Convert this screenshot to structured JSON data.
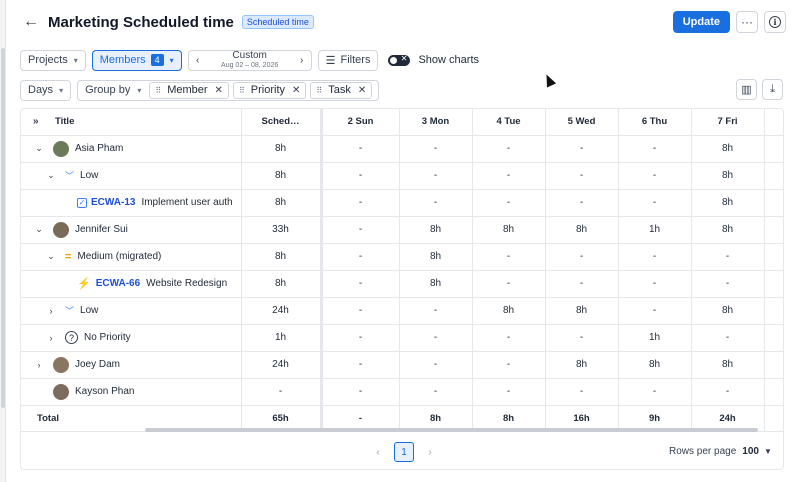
{
  "header": {
    "back_icon": "arrow-left-icon",
    "title": "Marketing Scheduled time",
    "badge": "Scheduled time",
    "update_label": "Update",
    "more_icon": "ellipsis-icon",
    "info_icon": "info-icon"
  },
  "toolbar": {
    "projects_label": "Projects",
    "members_label": "Members",
    "members_count": "4",
    "range_label": "Custom",
    "range_dates": "Aug 02 – 08, 2026",
    "filters_label": "Filters",
    "show_charts_label": "Show charts",
    "days_label": "Days",
    "group_by_label": "Group by",
    "group_chips": [
      "Member",
      "Priority",
      "Task"
    ]
  },
  "table": {
    "columns": [
      "Title",
      "Sched…",
      "2 Sun",
      "3 Mon",
      "4 Tue",
      "5 Wed",
      "6 Thu",
      "7 Fri"
    ],
    "rows": [
      {
        "level": 0,
        "caret": "⌄",
        "kind": "member",
        "name": "Asia Pham",
        "avatar_color": "#6b7b5a",
        "values": [
          "8h",
          "-",
          "-",
          "-",
          "-",
          "-",
          "8h"
        ]
      },
      {
        "level": 1,
        "caret": "⌄",
        "kind": "priority-low",
        "name": "Low",
        "values": [
          "8h",
          "-",
          "-",
          "-",
          "-",
          "-",
          "8h"
        ]
      },
      {
        "level": 2,
        "caret": "",
        "kind": "task-check",
        "tag": "ECWA-13",
        "name": "Implement user auth",
        "values": [
          "8h",
          "-",
          "-",
          "-",
          "-",
          "-",
          "8h"
        ]
      },
      {
        "level": 0,
        "caret": "⌄",
        "kind": "member",
        "name": "Jennifer Sui",
        "avatar_color": "#7a6a58",
        "values": [
          "33h",
          "-",
          "8h",
          "8h",
          "8h",
          "1h",
          "8h"
        ]
      },
      {
        "level": 1,
        "caret": "⌄",
        "kind": "priority-med",
        "name": "Medium (migrated)",
        "values": [
          "8h",
          "-",
          "8h",
          "-",
          "-",
          "-",
          "-"
        ]
      },
      {
        "level": 2,
        "caret": "",
        "kind": "task-bolt",
        "tag": "ECWA-66",
        "name": "Website Redesign",
        "values": [
          "8h",
          "-",
          "8h",
          "-",
          "-",
          "-",
          "-"
        ]
      },
      {
        "level": 1,
        "caret": "›",
        "kind": "priority-low",
        "name": "Low",
        "values": [
          "24h",
          "-",
          "-",
          "8h",
          "8h",
          "-",
          "8h"
        ]
      },
      {
        "level": 1,
        "caret": "›",
        "kind": "priority-none",
        "name": "No Priority",
        "values": [
          "1h",
          "-",
          "-",
          "-",
          "-",
          "1h",
          "-"
        ]
      },
      {
        "level": 0,
        "caret": "›",
        "kind": "member",
        "name": "Joey Dam",
        "avatar_color": "#8a7560",
        "values": [
          "24h",
          "-",
          "-",
          "-",
          "8h",
          "8h",
          "8h"
        ]
      },
      {
        "level": 0,
        "caret": "",
        "kind": "member",
        "name": "Kayson Phan",
        "avatar_color": "#7d6b5d",
        "values": [
          "-",
          "-",
          "-",
          "-",
          "-",
          "-",
          "-"
        ]
      }
    ],
    "total": {
      "label": "Total",
      "values": [
        "65h",
        "-",
        "8h",
        "8h",
        "16h",
        "9h",
        "24h"
      ]
    }
  },
  "pagination": {
    "prev_icon": "chevron-left-icon",
    "page": "1",
    "next_icon": "chevron-right-icon",
    "rows_per_page_label": "Rows per page",
    "rows_per_page_value": "100"
  }
}
